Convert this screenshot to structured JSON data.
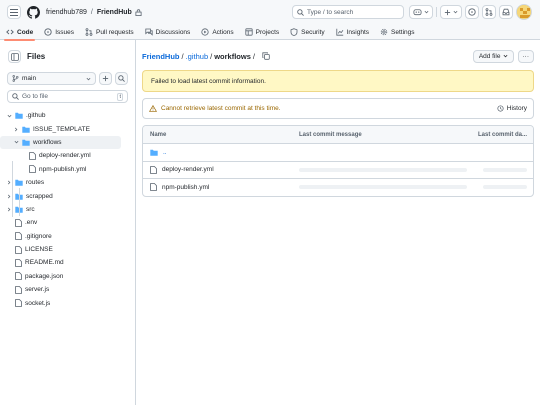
{
  "header": {
    "owner": "friendhub789",
    "separator": "/",
    "repo": "FriendHub",
    "search_placeholder": "Type / to search",
    "search_key": "/"
  },
  "tabs": [
    {
      "label": "Code",
      "icon": "code-icon",
      "active": true
    },
    {
      "label": "Issues",
      "icon": "issue-icon"
    },
    {
      "label": "Pull requests",
      "icon": "pull-request-icon"
    },
    {
      "label": "Discussions",
      "icon": "discussion-icon"
    },
    {
      "label": "Actions",
      "icon": "play-icon"
    },
    {
      "label": "Projects",
      "icon": "table-icon"
    },
    {
      "label": "Security",
      "icon": "shield-icon"
    },
    {
      "label": "Insights",
      "icon": "graph-icon"
    },
    {
      "label": "Settings",
      "icon": "gear-icon"
    }
  ],
  "sidebar": {
    "title": "Files",
    "branch": "main",
    "goto_placeholder": "Go to file",
    "goto_key": "t",
    "tree": [
      {
        "label": ".github",
        "type": "folder",
        "open": true
      },
      {
        "label": "ISSUE_TEMPLATE",
        "type": "folder"
      },
      {
        "label": "workflows",
        "type": "folder",
        "open": true,
        "selected": true
      },
      {
        "label": "deploy-render.yml",
        "type": "file"
      },
      {
        "label": "npm-publish.yml",
        "type": "file"
      },
      {
        "label": "routes",
        "type": "folder"
      },
      {
        "label": "scrapped",
        "type": "folder"
      },
      {
        "label": "src",
        "type": "folder"
      },
      {
        "label": ".env",
        "type": "file"
      },
      {
        "label": ".gitignore",
        "type": "file"
      },
      {
        "label": "LICENSE",
        "type": "file"
      },
      {
        "label": "README.md",
        "type": "file"
      },
      {
        "label": "package.json",
        "type": "file"
      },
      {
        "label": "server.js",
        "type": "file"
      },
      {
        "label": "socket.js",
        "type": "file"
      }
    ]
  },
  "content": {
    "path": {
      "repo": "FriendHub",
      "dir": ".github",
      "current": "workflows",
      "sep": "/"
    },
    "add_file": "Add file",
    "more": "···",
    "error": "Failed to load latest commit information.",
    "commit_warning": "Cannot retrieve latest commit at this time.",
    "history": "History",
    "table": {
      "headers": [
        "Name",
        "Last commit message",
        "Last commit da..."
      ],
      "rows": [
        {
          "name": "..",
          "type": "folder"
        },
        {
          "name": "deploy-render.yml",
          "type": "file"
        },
        {
          "name": "npm-publish.yml",
          "type": "file"
        }
      ]
    }
  },
  "colors": {
    "accent": "#0969da",
    "folder": "#54aeff",
    "warning_bg": "#fff8c5",
    "tab_underline": "#fd8c73"
  }
}
